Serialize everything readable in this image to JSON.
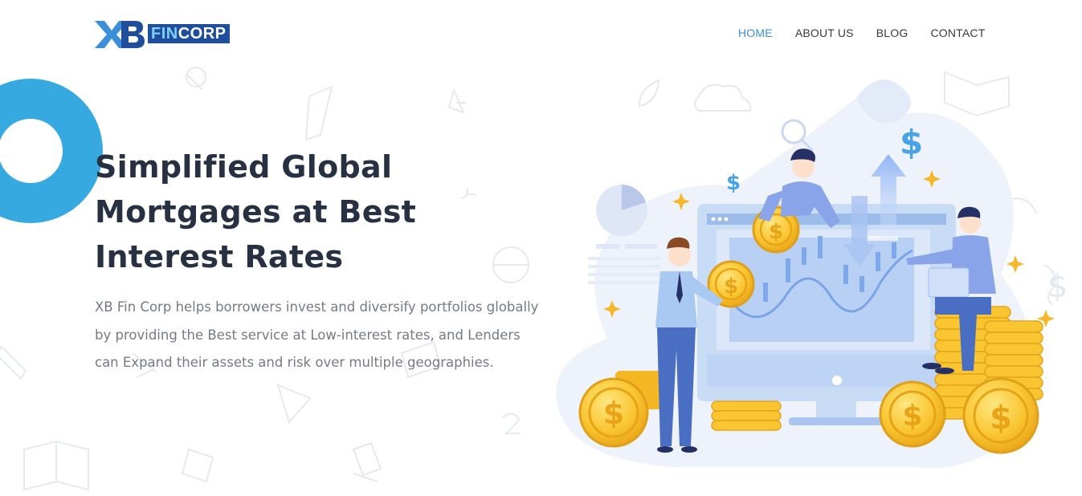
{
  "brand": {
    "logo_mark_text": "XB",
    "logo_word_first": "FIN",
    "logo_word_rest": "CORP",
    "colors": {
      "primary_blue": "#1f4f9c",
      "accent_light": "#7fd0ff",
      "ring_blue": "#36a9e1",
      "nav_active": "#3d8fd6"
    }
  },
  "nav": {
    "items": [
      {
        "label": "HOME",
        "active": true
      },
      {
        "label": "ABOUT US",
        "active": false
      },
      {
        "label": "BLOG",
        "active": false
      },
      {
        "label": "CONTACT",
        "active": false
      }
    ]
  },
  "hero": {
    "title_line1": "Simplified Global",
    "title_line2": "Mortgages at Best",
    "title_line3": "Interest Rates",
    "description": "XB Fin Corp helps borrowers invest and diversify portfolios globally by providing the Best service at Low-interest rates, and Lenders can Expand their assets and risk over multiple geographies."
  },
  "illustration": {
    "icon": "finance-growth-illustration",
    "dollar_symbol": "$"
  }
}
